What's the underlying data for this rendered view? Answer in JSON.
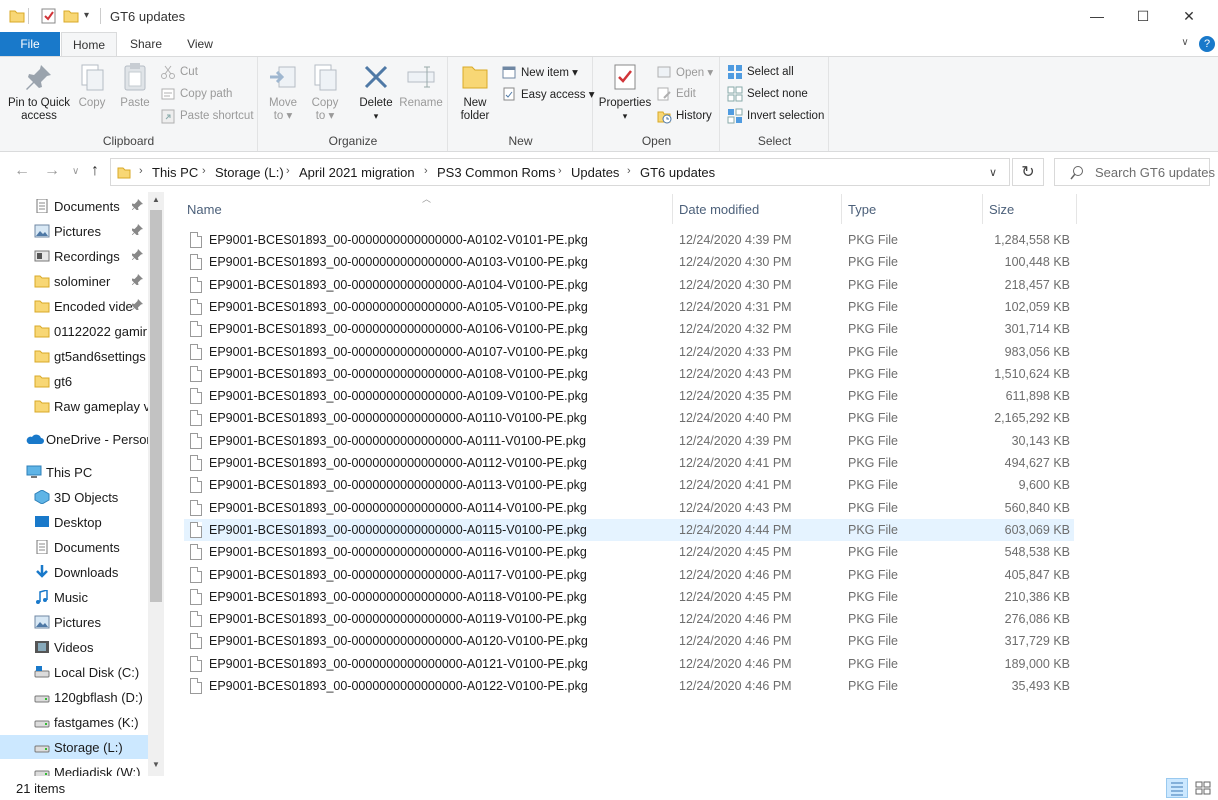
{
  "window": {
    "title": "GT6 updates",
    "minimize": "—",
    "maximize": "☐",
    "close": "✕"
  },
  "tabs": {
    "file": "File",
    "home": "Home",
    "share": "Share",
    "view": "View"
  },
  "ribbon": {
    "clipboard": {
      "label": "Clipboard",
      "pin": "Pin to Quick access",
      "pin_l1": "Pin to Quick",
      "pin_l2": "access",
      "copy": "Copy",
      "paste": "Paste",
      "cut": "Cut",
      "copy_path": "Copy path",
      "paste_shortcut": "Paste shortcut"
    },
    "organize": {
      "label": "Organize",
      "move_l1": "Move",
      "move_l2": "to ▾",
      "copy_l1": "Copy",
      "copy_l2": "to ▾",
      "delete": "Delete",
      "delete_arrow": "▾",
      "rename": "Rename"
    },
    "new": {
      "label": "New",
      "folder_l1": "New",
      "folder_l2": "folder",
      "new_item": "New item ▾",
      "easy_access": "Easy access ▾"
    },
    "open": {
      "label": "Open",
      "properties": "Properties",
      "properties_arrow": "▾",
      "open": "Open ▾",
      "edit": "Edit",
      "history": "History"
    },
    "select": {
      "label": "Select",
      "select_all": "Select all",
      "select_none": "Select none",
      "invert": "Invert selection"
    }
  },
  "address": {
    "crumbs": [
      "This PC",
      "Storage (L:)",
      "April 2021 migration",
      "PS3 Common Roms",
      "Updates",
      "GT6 updates"
    ],
    "search_placeholder": "Search GT6 updates"
  },
  "nav": {
    "quick": [
      {
        "label": "Documents",
        "pinned": true
      },
      {
        "label": "Pictures",
        "pinned": true
      },
      {
        "label": "Recordings",
        "pinned": true
      },
      {
        "label": "solominer",
        "pinned": true
      },
      {
        "label": "Encoded vide",
        "pinned": true
      },
      {
        "label": "01122022 gamir",
        "pinned": false
      },
      {
        "label": "gt5and6settings",
        "pinned": false
      },
      {
        "label": "gt6",
        "pinned": false
      },
      {
        "label": "Raw gameplay v",
        "pinned": false
      }
    ],
    "onedrive": "OneDrive - Person",
    "thispc": "This PC",
    "pc_items": [
      "3D Objects",
      "Desktop",
      "Documents",
      "Downloads",
      "Music",
      "Pictures",
      "Videos",
      "Local Disk (C:)",
      "120gbflash (D:)",
      "fastgames (K:)",
      "Storage (L:)",
      "Mediadisk (W:)"
    ],
    "pin_glyph": "📌"
  },
  "columns": {
    "name": "Name",
    "date": "Date modified",
    "type": "Type",
    "size": "Size"
  },
  "files": [
    {
      "name": "EP9001-BCES01893_00-0000000000000000-A0102-V0101-PE.pkg",
      "date": "12/24/2020 4:39 PM",
      "type": "PKG File",
      "size": "1,284,558 KB"
    },
    {
      "name": "EP9001-BCES01893_00-0000000000000000-A0103-V0100-PE.pkg",
      "date": "12/24/2020 4:30 PM",
      "type": "PKG File",
      "size": "100,448 KB"
    },
    {
      "name": "EP9001-BCES01893_00-0000000000000000-A0104-V0100-PE.pkg",
      "date": "12/24/2020 4:30 PM",
      "type": "PKG File",
      "size": "218,457 KB"
    },
    {
      "name": "EP9001-BCES01893_00-0000000000000000-A0105-V0100-PE.pkg",
      "date": "12/24/2020 4:31 PM",
      "type": "PKG File",
      "size": "102,059 KB"
    },
    {
      "name": "EP9001-BCES01893_00-0000000000000000-A0106-V0100-PE.pkg",
      "date": "12/24/2020 4:32 PM",
      "type": "PKG File",
      "size": "301,714 KB"
    },
    {
      "name": "EP9001-BCES01893_00-0000000000000000-A0107-V0100-PE.pkg",
      "date": "12/24/2020 4:33 PM",
      "type": "PKG File",
      "size": "983,056 KB"
    },
    {
      "name": "EP9001-BCES01893_00-0000000000000000-A0108-V0100-PE.pkg",
      "date": "12/24/2020 4:43 PM",
      "type": "PKG File",
      "size": "1,510,624 KB"
    },
    {
      "name": "EP9001-BCES01893_00-0000000000000000-A0109-V0100-PE.pkg",
      "date": "12/24/2020 4:35 PM",
      "type": "PKG File",
      "size": "611,898 KB"
    },
    {
      "name": "EP9001-BCES01893_00-0000000000000000-A0110-V0100-PE.pkg",
      "date": "12/24/2020 4:40 PM",
      "type": "PKG File",
      "size": "2,165,292 KB"
    },
    {
      "name": "EP9001-BCES01893_00-0000000000000000-A0111-V0100-PE.pkg",
      "date": "12/24/2020 4:39 PM",
      "type": "PKG File",
      "size": "30,143 KB"
    },
    {
      "name": "EP9001-BCES01893_00-0000000000000000-A0112-V0100-PE.pkg",
      "date": "12/24/2020 4:41 PM",
      "type": "PKG File",
      "size": "494,627 KB"
    },
    {
      "name": "EP9001-BCES01893_00-0000000000000000-A0113-V0100-PE.pkg",
      "date": "12/24/2020 4:41 PM",
      "type": "PKG File",
      "size": "9,600 KB"
    },
    {
      "name": "EP9001-BCES01893_00-0000000000000000-A0114-V0100-PE.pkg",
      "date": "12/24/2020 4:43 PM",
      "type": "PKG File",
      "size": "560,840 KB"
    },
    {
      "name": "EP9001-BCES01893_00-0000000000000000-A0115-V0100-PE.pkg",
      "date": "12/24/2020 4:44 PM",
      "type": "PKG File",
      "size": "603,069 KB",
      "selected": true
    },
    {
      "name": "EP9001-BCES01893_00-0000000000000000-A0116-V0100-PE.pkg",
      "date": "12/24/2020 4:45 PM",
      "type": "PKG File",
      "size": "548,538 KB"
    },
    {
      "name": "EP9001-BCES01893_00-0000000000000000-A0117-V0100-PE.pkg",
      "date": "12/24/2020 4:46 PM",
      "type": "PKG File",
      "size": "405,847 KB"
    },
    {
      "name": "EP9001-BCES01893_00-0000000000000000-A0118-V0100-PE.pkg",
      "date": "12/24/2020 4:45 PM",
      "type": "PKG File",
      "size": "210,386 KB"
    },
    {
      "name": "EP9001-BCES01893_00-0000000000000000-A0119-V0100-PE.pkg",
      "date": "12/24/2020 4:46 PM",
      "type": "PKG File",
      "size": "276,086 KB"
    },
    {
      "name": "EP9001-BCES01893_00-0000000000000000-A0120-V0100-PE.pkg",
      "date": "12/24/2020 4:46 PM",
      "type": "PKG File",
      "size": "317,729 KB"
    },
    {
      "name": "EP9001-BCES01893_00-0000000000000000-A0121-V0100-PE.pkg",
      "date": "12/24/2020 4:46 PM",
      "type": "PKG File",
      "size": "189,000 KB"
    },
    {
      "name": "EP9001-BCES01893_00-0000000000000000-A0122-V0100-PE.pkg",
      "date": "12/24/2020 4:46 PM",
      "type": "PKG File",
      "size": "35,493 KB"
    }
  ],
  "status": {
    "count": "21 items"
  },
  "colors": {
    "accent": "#1979ca",
    "selection": "#cce8ff",
    "hover_row": "#e5f3ff",
    "folder": "#f8d775"
  }
}
